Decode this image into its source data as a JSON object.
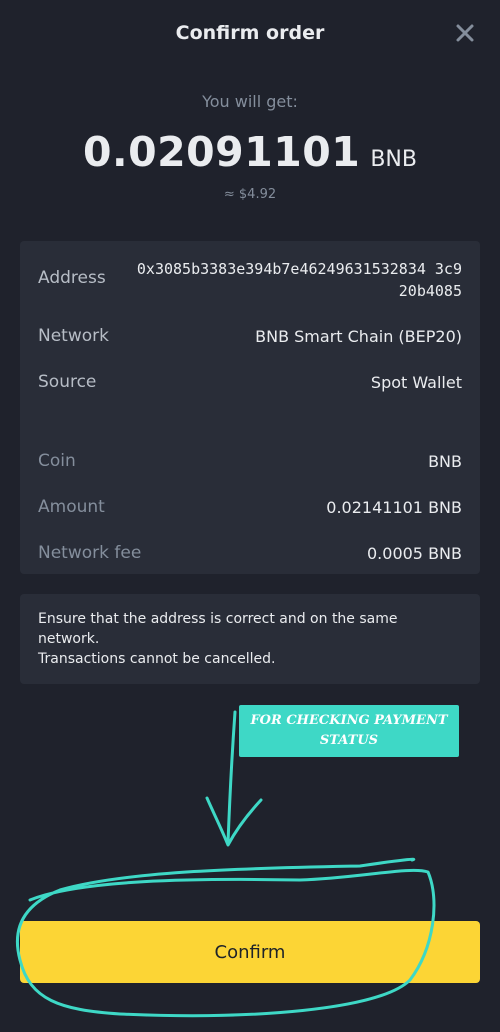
{
  "header": {
    "title": "Confirm order",
    "close_icon": "close-icon"
  },
  "summary": {
    "label": "You will get:",
    "amount": "0.02091101",
    "unit": "BNB",
    "usd": "≈ $4.92"
  },
  "details": {
    "address_label": "Address",
    "address_value": "0x3085b3383e394b7e46249631532834 3c920b4085",
    "network_label": "Network",
    "network_value": "BNB Smart Chain (BEP20)",
    "source_label": "Source",
    "source_value": "Spot Wallet",
    "coin_label": "Coin",
    "coin_value": "BNB",
    "amount_label": "Amount",
    "amount_value": "0.02141101 BNB",
    "fee_label": "Network fee",
    "fee_value": "0.0005 BNB"
  },
  "notice": {
    "text": "Ensure that the address is correct and on the same network.\nTransactions cannot be cancelled."
  },
  "annotation": {
    "text": "FOR CHECKING PAYMENT STATUS",
    "color": "#3ed8c6"
  },
  "confirm": {
    "label": "Confirm",
    "color": "#fcd535"
  }
}
